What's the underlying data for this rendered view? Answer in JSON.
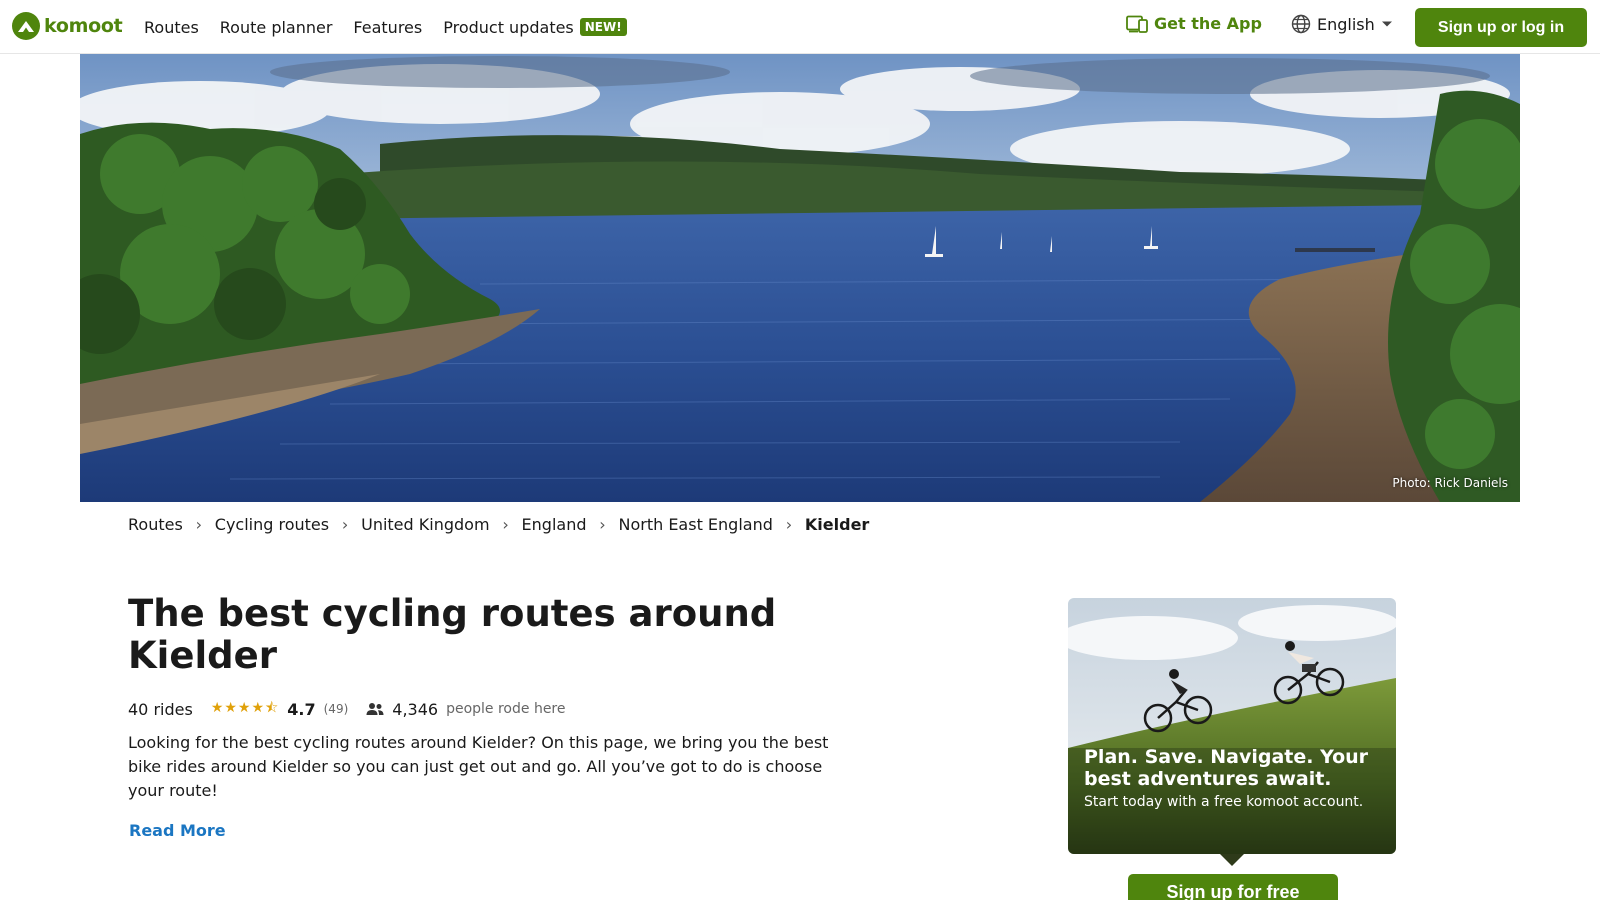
{
  "header": {
    "logo_text": "komoot",
    "nav": [
      {
        "label": "Routes"
      },
      {
        "label": "Route planner"
      },
      {
        "label": "Features"
      },
      {
        "label": "Product updates",
        "badge": "NEW!"
      }
    ],
    "get_app": "Get the App",
    "language": "English",
    "signin": "Sign up or log in"
  },
  "hero": {
    "photo_credit": "Photo: Rick Daniels"
  },
  "breadcrumb": [
    "Routes",
    "Cycling routes",
    "United Kingdom",
    "England",
    "North East England",
    "Kielder"
  ],
  "main": {
    "title": "The best cycling routes around Kielder",
    "rides": "40 rides",
    "stars": "★★★★⯪",
    "star_fraction": 0.94,
    "rating": "4.7",
    "rating_count": "(49)",
    "people_count": "4,346",
    "people_label": "people rode here",
    "description": "Looking for the best cycling routes around Kielder? On this page, we bring you the best bike rides around Kielder so you can just get out and go. All you’ve got to do is choose your route!",
    "read_more": "Read More"
  },
  "promo": {
    "headline": "Plan. Save. Navigate. Your best adventures await.",
    "subtext": "Start today with a free komoot account.",
    "button": "Sign up for free"
  },
  "colors": {
    "brand_green": "#4f850d",
    "link_blue": "#1b76c2",
    "star_gold": "#e0a10a"
  }
}
